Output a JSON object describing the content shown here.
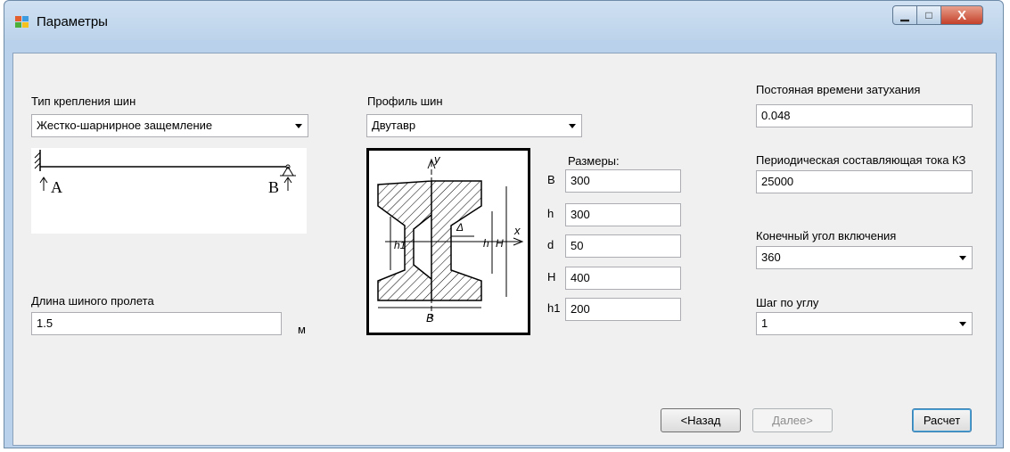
{
  "window": {
    "title": "Параметры",
    "min_glyph": "▁",
    "max_glyph": "□",
    "close_glyph": "X"
  },
  "left": {
    "mount_type_label": "Тип крепления шин",
    "mount_type_value": "Жестко-шарнирное защемление",
    "diagram_label_a": "A",
    "diagram_label_b": "B",
    "span_label": "Длина шиного пролета",
    "span_value": "1.5",
    "span_unit": "м"
  },
  "middle": {
    "profile_label": "Профиль шин",
    "profile_value": "Двутавр",
    "dims_label": "Размеры:",
    "drawing_labels": {
      "y": "y",
      "x": "x",
      "delta": "Δ",
      "h1": "h1",
      "h": "h",
      "H": "H",
      "B": "B"
    },
    "dims": [
      {
        "label": "B",
        "value": "300"
      },
      {
        "label": "h",
        "value": "300"
      },
      {
        "label": "d",
        "value": "50"
      },
      {
        "label": "H",
        "value": "400"
      },
      {
        "label": "h1",
        "value": "200"
      }
    ]
  },
  "right": {
    "decay_label": "Постояная времени затухания",
    "decay_value": "0.048",
    "periodic_label": "Периодическая составляющая тока КЗ",
    "periodic_value": "25000",
    "angle_label": "Конечный угол включения",
    "angle_value": "360",
    "step_label": "Шаг по углу",
    "step_value": "1"
  },
  "buttons": {
    "back": "<Назад",
    "next": "Далее>",
    "calc": "Расчет"
  },
  "colors": {
    "frame": "#b9d1ea",
    "client": "#f0f0f0",
    "close": "#c4402a"
  }
}
